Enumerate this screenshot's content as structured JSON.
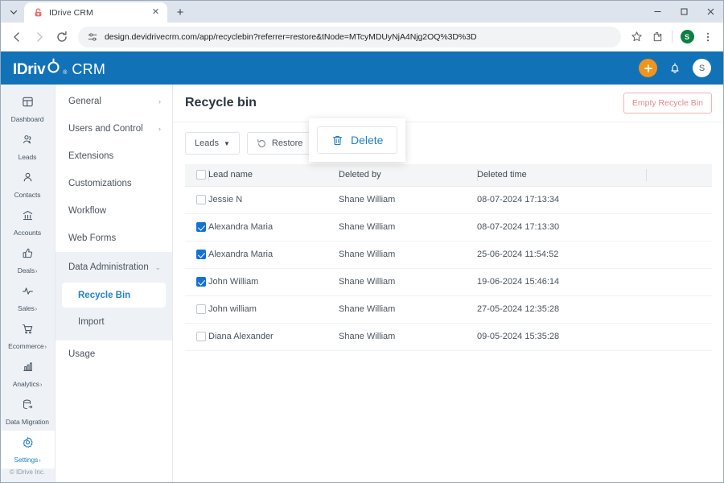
{
  "browser": {
    "tab": {
      "title": "IDrive CRM",
      "favicon_icon": "idrive-lock-icon",
      "close_icon": "close-icon"
    },
    "tab_list_icon": "chevron-down-icon",
    "new_tab_icon": "plus-icon",
    "window_controls": {
      "minimize": "minimize-icon",
      "maximize": "maximize-icon",
      "close": "close-icon"
    },
    "nav": {
      "back_icon": "back-arrow-icon",
      "forward_icon": "forward-arrow-icon",
      "reload_icon": "reload-icon"
    },
    "omnibox": {
      "site_info_icon": "tune-icon",
      "url": "design.devidrivecrm.com/app/recyclebin?referrer=restore&tNode=MTcyMDUyNjA4Njg2OQ%3D%3D"
    },
    "toolbar_icons": {
      "bookmark": "star-icon",
      "extensions": "puzzle-icon",
      "menu": "kebab-menu-icon"
    },
    "profile_initial": "S"
  },
  "app_header": {
    "brand_main": "IDriv",
    "brand_e": "e",
    "brand_reg": "®",
    "brand_suffix": "CRM",
    "add_icon": "plus-icon",
    "notifications_icon": "bell-icon",
    "avatar_initial": "S",
    "bg_color": "#1272b8",
    "add_btn_color": "#f0941e"
  },
  "rail": {
    "items": [
      {
        "label": "Dashboard",
        "icon": "dashboard-icon",
        "chevron": "",
        "active": false
      },
      {
        "label": "Leads",
        "icon": "leads-icon",
        "chevron": "",
        "active": false
      },
      {
        "label": "Contacts",
        "icon": "contacts-icon",
        "chevron": "",
        "active": false
      },
      {
        "label": "Accounts",
        "icon": "accounts-icon",
        "chevron": "",
        "active": false
      },
      {
        "label": "Deals",
        "icon": "deals-icon",
        "chevron": "›",
        "active": false
      },
      {
        "label": "Sales",
        "icon": "sales-icon",
        "chevron": "›",
        "active": false
      },
      {
        "label": "Ecommerce",
        "icon": "ecommerce-icon",
        "chevron": "›",
        "active": false
      },
      {
        "label": "Analytics",
        "icon": "analytics-icon",
        "chevron": "›",
        "active": false
      },
      {
        "label": "Data Migration",
        "icon": "data-migration-icon",
        "chevron": "",
        "active": false
      },
      {
        "label": "Settings",
        "icon": "gear-icon",
        "chevron": "›",
        "active": true
      }
    ],
    "footer": "© IDrive Inc."
  },
  "subnav": {
    "items": [
      {
        "label": "General",
        "chevron": "›"
      },
      {
        "label": "Users and Control",
        "chevron": "›"
      },
      {
        "label": "Extensions",
        "chevron": ""
      },
      {
        "label": "Customizations",
        "chevron": ""
      },
      {
        "label": "Workflow",
        "chevron": ""
      },
      {
        "label": "Web Forms",
        "chevron": ""
      }
    ],
    "group": {
      "label": "Data Administration",
      "chevron": "⌄",
      "children": [
        {
          "label": "Recycle Bin",
          "active": true
        },
        {
          "label": "Import",
          "active": false
        }
      ]
    },
    "trailing": [
      {
        "label": "Usage",
        "chevron": ""
      }
    ]
  },
  "main": {
    "title": "Recycle bin",
    "empty_button": "Empty Recycle Bin",
    "toolbar": {
      "module_filter": "Leads",
      "module_caret": "▼",
      "restore_label": "Restore",
      "restore_icon": "restore-icon"
    },
    "delete_popup": {
      "label": "Delete",
      "icon": "trash-icon",
      "color": "#2481c7"
    },
    "table": {
      "columns": [
        "Lead name",
        "Deleted by",
        "Deleted time",
        ""
      ],
      "header_checkbox_checked": false,
      "rows": [
        {
          "checked": false,
          "name": "Jessie N",
          "deleted_by": "Shane William",
          "deleted_time": "08-07-2024 17:13:34"
        },
        {
          "checked": true,
          "name": "Alexandra Maria",
          "deleted_by": "Shane William",
          "deleted_time": "08-07-2024 17:13:30"
        },
        {
          "checked": true,
          "name": "Alexandra Maria",
          "deleted_by": "Shane William",
          "deleted_time": "25-06-2024 11:54:52"
        },
        {
          "checked": true,
          "name": "John William",
          "deleted_by": "Shane William",
          "deleted_time": "19-06-2024 15:46:14"
        },
        {
          "checked": false,
          "name": "John william",
          "deleted_by": "Shane William",
          "deleted_time": "27-05-2024 12:35:28"
        },
        {
          "checked": false,
          "name": "Diana Alexander",
          "deleted_by": "Shane William",
          "deleted_time": "09-05-2024 15:35:28"
        }
      ]
    }
  }
}
